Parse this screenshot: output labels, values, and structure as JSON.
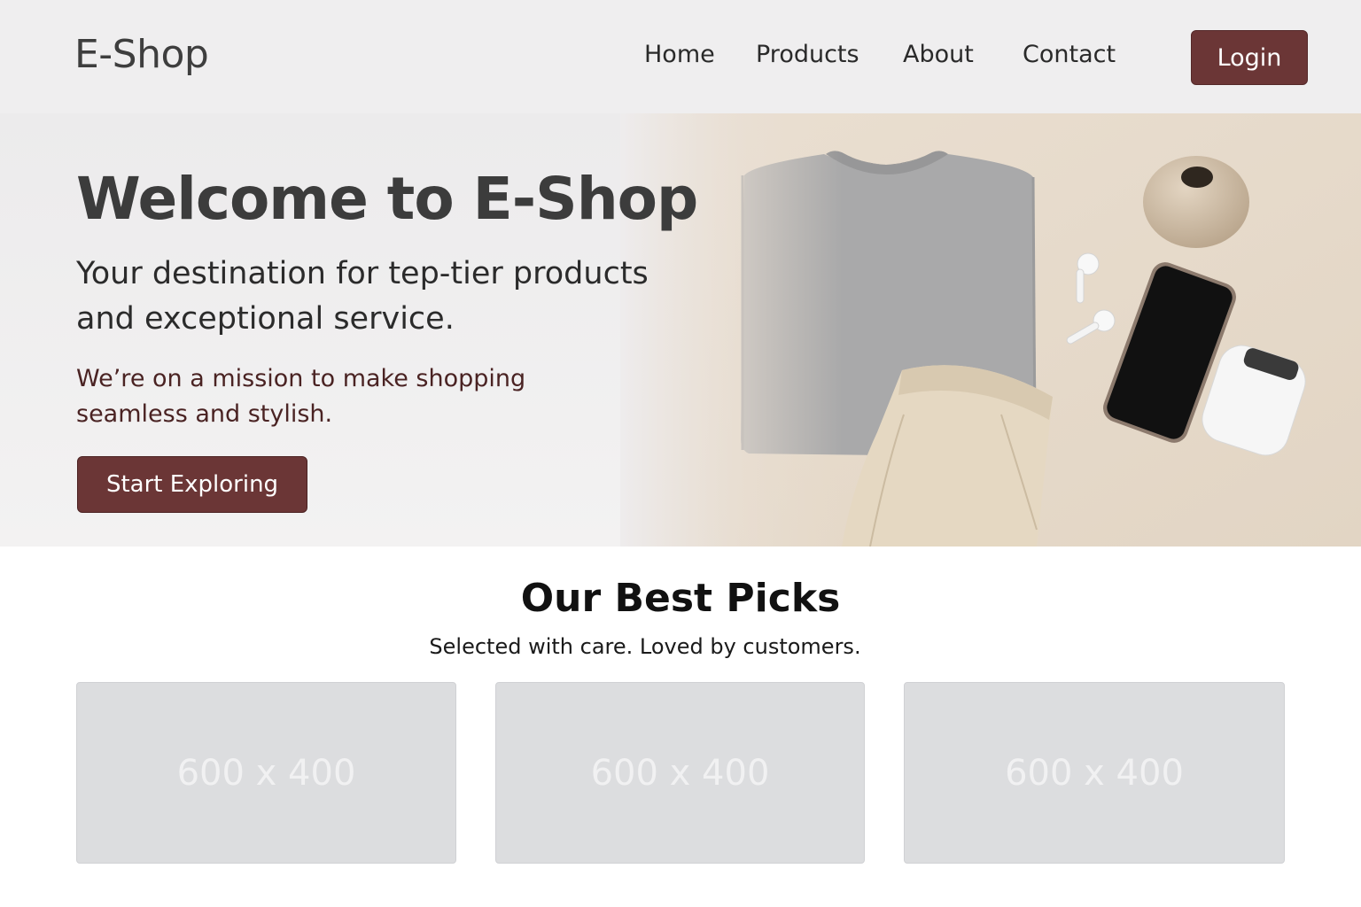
{
  "header": {
    "logo": "E-Shop",
    "nav": [
      "Home",
      "Products",
      "About",
      "Contact"
    ],
    "login_label": "Login"
  },
  "hero": {
    "title": "Welcome to E-Shop",
    "subtitle": "Your destination for tep-tier products and exceptional service.",
    "mission": "We’re on a mission to make shopping seamless and stylish.",
    "cta_label": "Start Exploring"
  },
  "picks": {
    "title": "Our Best Picks",
    "subtitle": "Selected with care. Loved by customers.",
    "cards": [
      {
        "placeholder": "600 x 400"
      },
      {
        "placeholder": "600 x 400"
      },
      {
        "placeholder": "600 x 400"
      }
    ]
  },
  "colors": {
    "accent": "#6b3636",
    "header_bg": "#efeeef",
    "card_bg": "#dcdddf"
  }
}
